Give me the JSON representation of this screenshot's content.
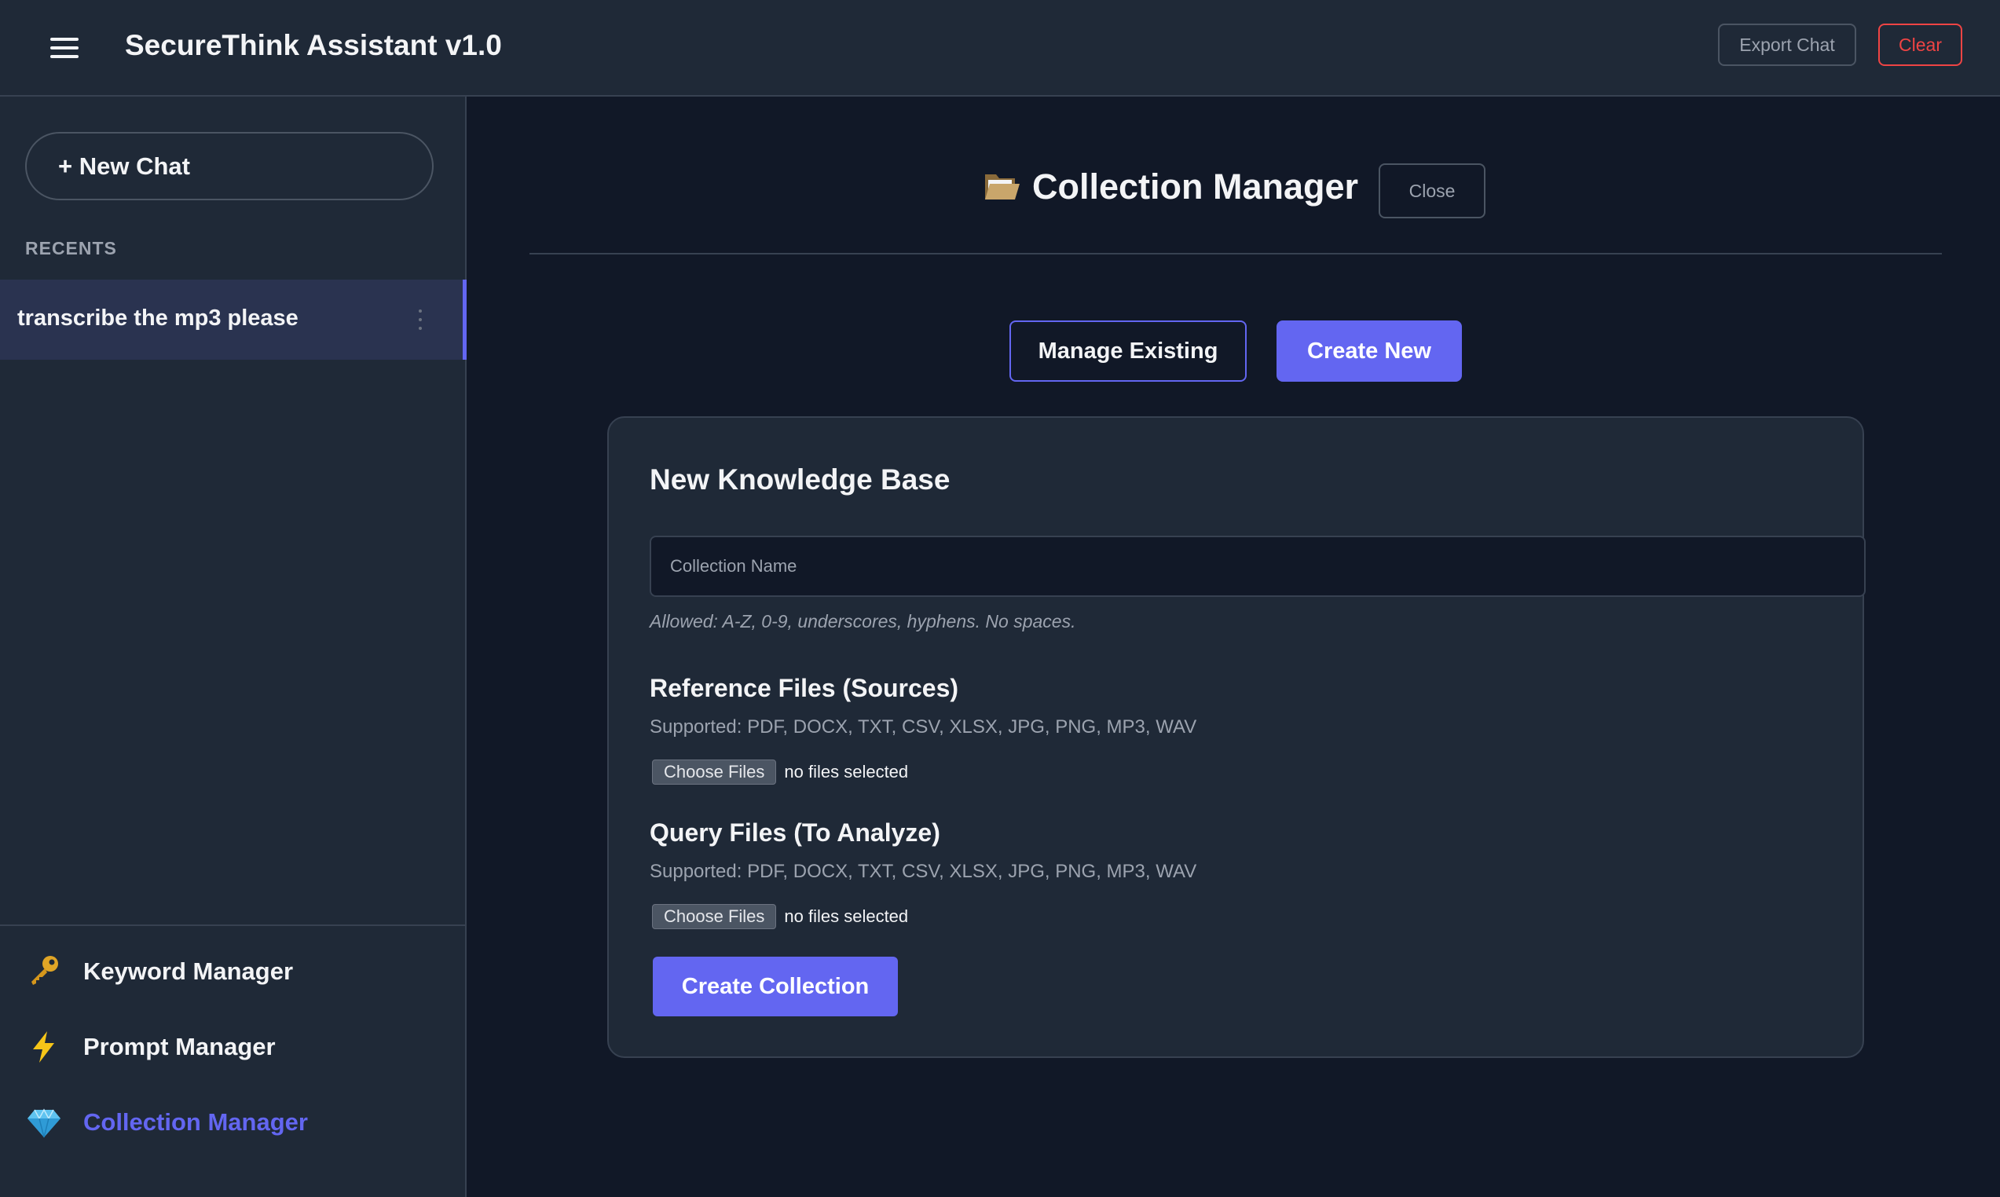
{
  "header": {
    "title": "SecureThink Assistant v1.0",
    "export_label": "Export Chat",
    "clear_label": "Clear"
  },
  "sidebar": {
    "new_chat_label": "+ New Chat",
    "recents_label": "RECENTS",
    "recents": [
      {
        "title": "transcribe the mp3 please"
      }
    ],
    "nav": [
      {
        "label": "Keyword Manager",
        "icon": "key-icon"
      },
      {
        "label": "Prompt Manager",
        "icon": "lightning-icon"
      },
      {
        "label": "Collection Manager",
        "icon": "gem-icon",
        "active": true
      }
    ]
  },
  "main": {
    "title": "Collection Manager",
    "title_icon": "folder-icon",
    "close_label": "Close",
    "tabs": [
      {
        "label": "Manage Existing",
        "active": false
      },
      {
        "label": "Create New",
        "active": true
      }
    ],
    "form": {
      "title": "New Knowledge Base",
      "name_placeholder": "Collection Name",
      "name_value": "",
      "name_hint": "Allowed: A-Z, 0-9, underscores, hyphens. No spaces.",
      "reference": {
        "title": "Reference Files (Sources)",
        "supported": "Supported: PDF, DOCX, TXT, CSV, XLSX, JPG, PNG, MP3, WAV",
        "choose_label": "Choose Files",
        "status": "no files selected"
      },
      "query": {
        "title": "Query Files (To Analyze)",
        "supported": "Supported: PDF, DOCX, TXT, CSV, XLSX, JPG, PNG, MP3, WAV",
        "choose_label": "Choose Files",
        "status": "no files selected"
      },
      "submit_label": "Create Collection"
    }
  },
  "colors": {
    "accent": "#6366f1",
    "danger": "#ef4444",
    "background": "#111827",
    "panel": "#1f2937"
  }
}
